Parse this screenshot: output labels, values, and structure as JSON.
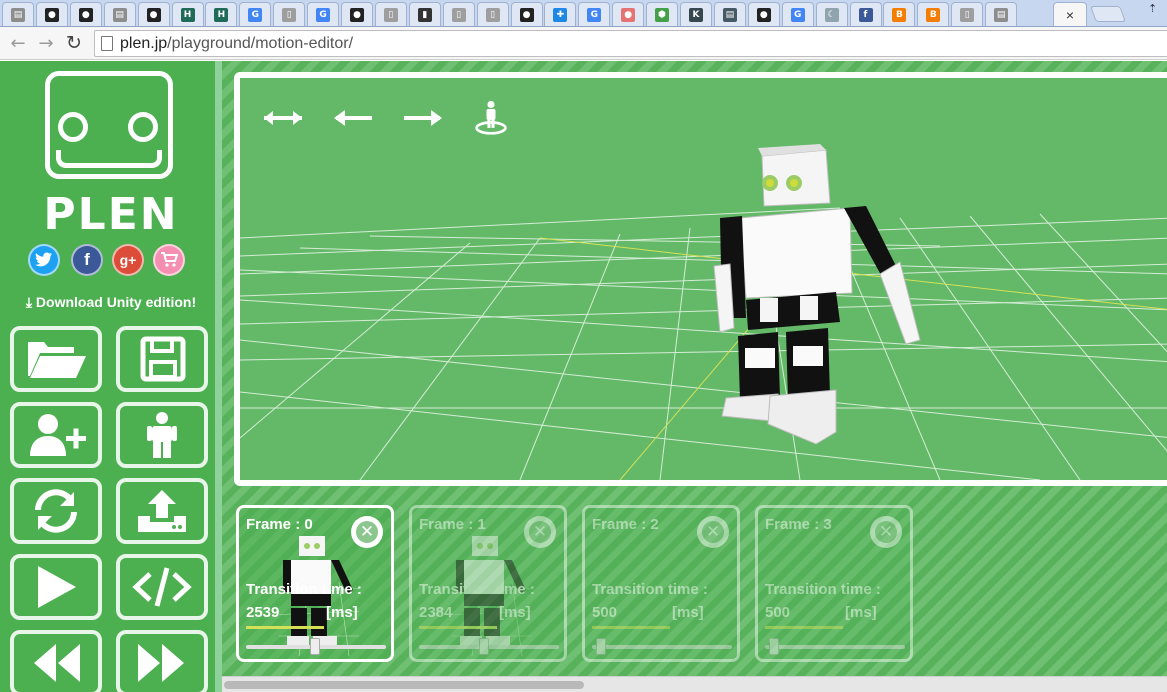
{
  "browser": {
    "tabs": [
      {
        "icon": "image-icon",
        "color": "#8d8d8d",
        "glyph": "▤"
      },
      {
        "icon": "github-icon",
        "color": "#222222",
        "glyph": "●"
      },
      {
        "icon": "github-icon",
        "color": "#222222",
        "glyph": "●"
      },
      {
        "icon": "image-icon",
        "color": "#8d8d8d",
        "glyph": "▤"
      },
      {
        "icon": "github-icon",
        "color": "#222222",
        "glyph": "●"
      },
      {
        "icon": "h-icon",
        "color": "#1f6b57",
        "glyph": "H"
      },
      {
        "icon": "h-icon",
        "color": "#1f6b57",
        "glyph": "H"
      },
      {
        "icon": "google-icon",
        "color": "#4285f4",
        "glyph": "G"
      },
      {
        "icon": "page-icon",
        "color": "#9e9e9e",
        "glyph": "▯"
      },
      {
        "icon": "google-icon",
        "color": "#4285f4",
        "glyph": "G"
      },
      {
        "icon": "github-icon",
        "color": "#222222",
        "glyph": "●"
      },
      {
        "icon": "page-icon",
        "color": "#9e9e9e",
        "glyph": "▯"
      },
      {
        "icon": "book-icon",
        "color": "#333333",
        "glyph": "▮"
      },
      {
        "icon": "page-icon",
        "color": "#9e9e9e",
        "glyph": "▯"
      },
      {
        "icon": "page-icon",
        "color": "#9e9e9e",
        "glyph": "▯"
      },
      {
        "icon": "github-icon",
        "color": "#222222",
        "glyph": "●"
      },
      {
        "icon": "wrench-icon",
        "color": "#1e88e5",
        "glyph": "✚"
      },
      {
        "icon": "google-icon",
        "color": "#4285f4",
        "glyph": "G"
      },
      {
        "icon": "chat-icon",
        "color": "#e57373",
        "glyph": "●"
      },
      {
        "icon": "hexagon-icon",
        "color": "#43a047",
        "glyph": "⬢"
      },
      {
        "icon": "k-icon",
        "color": "#37474f",
        "glyph": "K"
      },
      {
        "icon": "image-icon",
        "color": "#455a64",
        "glyph": "▤"
      },
      {
        "icon": "github-icon",
        "color": "#222222",
        "glyph": "●"
      },
      {
        "icon": "google-icon",
        "color": "#4285f4",
        "glyph": "G"
      },
      {
        "icon": "moon-icon",
        "color": "#90a4ae",
        "glyph": "☾"
      },
      {
        "icon": "facebook-icon",
        "color": "#3b5998",
        "glyph": "f"
      },
      {
        "icon": "blogger-icon",
        "color": "#f57d00",
        "glyph": "B"
      },
      {
        "icon": "blogger-icon",
        "color": "#f57d00",
        "glyph": "B"
      },
      {
        "icon": "page-icon",
        "color": "#9e9e9e",
        "glyph": "▯"
      },
      {
        "icon": "image-icon",
        "color": "#8d8d8d",
        "glyph": "▤"
      }
    ],
    "active_tab_close": "×",
    "url_host": "plen.jp",
    "url_path": "/playground/motion-editor/"
  },
  "sidebar": {
    "logo_text": "PLEN",
    "social": [
      {
        "name": "twitter",
        "glyph": "t",
        "color": "#1da1f2"
      },
      {
        "name": "facebook",
        "glyph": "f",
        "color": "#3b5998"
      },
      {
        "name": "google-plus",
        "glyph": "g+",
        "color": "#dd4b39"
      },
      {
        "name": "cart",
        "glyph": "🛒",
        "color": "#f48fb1"
      }
    ],
    "download_label": "Download Unity edition!"
  },
  "frames": [
    {
      "title": "Frame : 0",
      "transition_label": "Transition time :",
      "value": "2539",
      "unit": "[ms]",
      "level": 0.46,
      "active": true
    },
    {
      "title": "Frame : 1",
      "transition_label": "Transition time :",
      "value": "2384",
      "unit": "[ms]",
      "level": 0.43,
      "active": false
    },
    {
      "title": "Frame : 2",
      "transition_label": "Transition time :",
      "value": "500",
      "unit": "[ms]",
      "level": 0.03,
      "active": false
    },
    {
      "title": "Frame : 3",
      "transition_label": "Transition time :",
      "value": "500",
      "unit": "[ms]",
      "level": 0.03,
      "active": false
    }
  ],
  "colors": {
    "brand_green": "#4caf50",
    "viewport_green": "#63b968",
    "accent_yellow": "#d4e157"
  }
}
